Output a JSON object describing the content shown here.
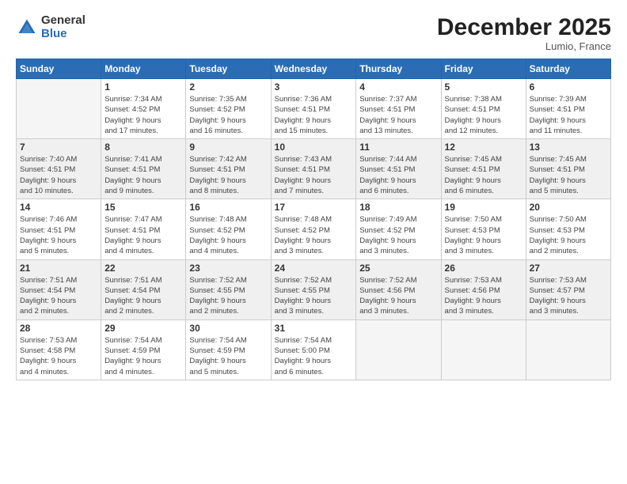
{
  "header": {
    "logo_general": "General",
    "logo_blue": "Blue",
    "month_year": "December 2025",
    "location": "Lumio, France"
  },
  "days_of_week": [
    "Sunday",
    "Monday",
    "Tuesday",
    "Wednesday",
    "Thursday",
    "Friday",
    "Saturday"
  ],
  "weeks": [
    [
      {
        "num": "",
        "info": ""
      },
      {
        "num": "1",
        "info": "Sunrise: 7:34 AM\nSunset: 4:52 PM\nDaylight: 9 hours\nand 17 minutes."
      },
      {
        "num": "2",
        "info": "Sunrise: 7:35 AM\nSunset: 4:52 PM\nDaylight: 9 hours\nand 16 minutes."
      },
      {
        "num": "3",
        "info": "Sunrise: 7:36 AM\nSunset: 4:51 PM\nDaylight: 9 hours\nand 15 minutes."
      },
      {
        "num": "4",
        "info": "Sunrise: 7:37 AM\nSunset: 4:51 PM\nDaylight: 9 hours\nand 13 minutes."
      },
      {
        "num": "5",
        "info": "Sunrise: 7:38 AM\nSunset: 4:51 PM\nDaylight: 9 hours\nand 12 minutes."
      },
      {
        "num": "6",
        "info": "Sunrise: 7:39 AM\nSunset: 4:51 PM\nDaylight: 9 hours\nand 11 minutes."
      }
    ],
    [
      {
        "num": "7",
        "info": "Sunrise: 7:40 AM\nSunset: 4:51 PM\nDaylight: 9 hours\nand 10 minutes."
      },
      {
        "num": "8",
        "info": "Sunrise: 7:41 AM\nSunset: 4:51 PM\nDaylight: 9 hours\nand 9 minutes."
      },
      {
        "num": "9",
        "info": "Sunrise: 7:42 AM\nSunset: 4:51 PM\nDaylight: 9 hours\nand 8 minutes."
      },
      {
        "num": "10",
        "info": "Sunrise: 7:43 AM\nSunset: 4:51 PM\nDaylight: 9 hours\nand 7 minutes."
      },
      {
        "num": "11",
        "info": "Sunrise: 7:44 AM\nSunset: 4:51 PM\nDaylight: 9 hours\nand 6 minutes."
      },
      {
        "num": "12",
        "info": "Sunrise: 7:45 AM\nSunset: 4:51 PM\nDaylight: 9 hours\nand 6 minutes."
      },
      {
        "num": "13",
        "info": "Sunrise: 7:45 AM\nSunset: 4:51 PM\nDaylight: 9 hours\nand 5 minutes."
      }
    ],
    [
      {
        "num": "14",
        "info": "Sunrise: 7:46 AM\nSunset: 4:51 PM\nDaylight: 9 hours\nand 5 minutes."
      },
      {
        "num": "15",
        "info": "Sunrise: 7:47 AM\nSunset: 4:51 PM\nDaylight: 9 hours\nand 4 minutes."
      },
      {
        "num": "16",
        "info": "Sunrise: 7:48 AM\nSunset: 4:52 PM\nDaylight: 9 hours\nand 4 minutes."
      },
      {
        "num": "17",
        "info": "Sunrise: 7:48 AM\nSunset: 4:52 PM\nDaylight: 9 hours\nand 3 minutes."
      },
      {
        "num": "18",
        "info": "Sunrise: 7:49 AM\nSunset: 4:52 PM\nDaylight: 9 hours\nand 3 minutes."
      },
      {
        "num": "19",
        "info": "Sunrise: 7:50 AM\nSunset: 4:53 PM\nDaylight: 9 hours\nand 3 minutes."
      },
      {
        "num": "20",
        "info": "Sunrise: 7:50 AM\nSunset: 4:53 PM\nDaylight: 9 hours\nand 2 minutes."
      }
    ],
    [
      {
        "num": "21",
        "info": "Sunrise: 7:51 AM\nSunset: 4:54 PM\nDaylight: 9 hours\nand 2 minutes."
      },
      {
        "num": "22",
        "info": "Sunrise: 7:51 AM\nSunset: 4:54 PM\nDaylight: 9 hours\nand 2 minutes."
      },
      {
        "num": "23",
        "info": "Sunrise: 7:52 AM\nSunset: 4:55 PM\nDaylight: 9 hours\nand 2 minutes."
      },
      {
        "num": "24",
        "info": "Sunrise: 7:52 AM\nSunset: 4:55 PM\nDaylight: 9 hours\nand 3 minutes."
      },
      {
        "num": "25",
        "info": "Sunrise: 7:52 AM\nSunset: 4:56 PM\nDaylight: 9 hours\nand 3 minutes."
      },
      {
        "num": "26",
        "info": "Sunrise: 7:53 AM\nSunset: 4:56 PM\nDaylight: 9 hours\nand 3 minutes."
      },
      {
        "num": "27",
        "info": "Sunrise: 7:53 AM\nSunset: 4:57 PM\nDaylight: 9 hours\nand 3 minutes."
      }
    ],
    [
      {
        "num": "28",
        "info": "Sunrise: 7:53 AM\nSunset: 4:58 PM\nDaylight: 9 hours\nand 4 minutes."
      },
      {
        "num": "29",
        "info": "Sunrise: 7:54 AM\nSunset: 4:59 PM\nDaylight: 9 hours\nand 4 minutes."
      },
      {
        "num": "30",
        "info": "Sunrise: 7:54 AM\nSunset: 4:59 PM\nDaylight: 9 hours\nand 5 minutes."
      },
      {
        "num": "31",
        "info": "Sunrise: 7:54 AM\nSunset: 5:00 PM\nDaylight: 9 hours\nand 6 minutes."
      },
      {
        "num": "",
        "info": ""
      },
      {
        "num": "",
        "info": ""
      },
      {
        "num": "",
        "info": ""
      }
    ]
  ]
}
